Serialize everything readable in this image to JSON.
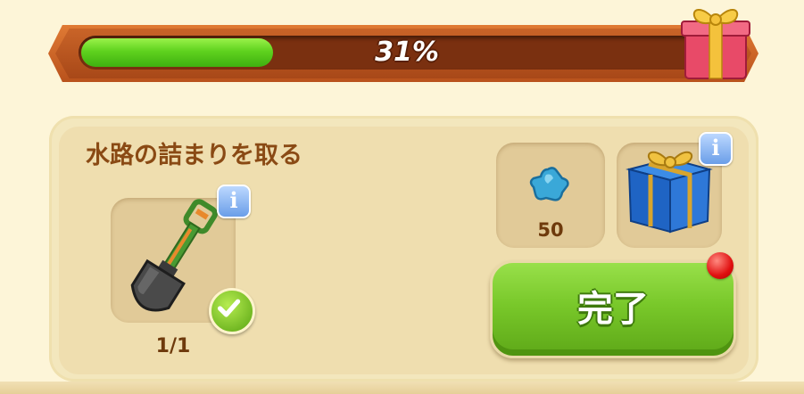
{
  "progress": {
    "percent": 0.31,
    "label": "31%"
  },
  "task": {
    "title": "水路の詰まりを取る",
    "item_count": "1/1",
    "item_icon": "shovel-icon",
    "item_completed": true
  },
  "rewards": [
    {
      "icon": "blue-gem-icon",
      "value": "50"
    },
    {
      "icon": "blue-gift-box-icon",
      "value": ""
    }
  ],
  "complete_button": {
    "label": "完了",
    "has_notification": true
  },
  "colors": {
    "progress_fill": "#5fd21e",
    "banner": "#c96428",
    "button": "#79c82a",
    "title_text": "#8a4a14",
    "notification": "#e01010"
  }
}
